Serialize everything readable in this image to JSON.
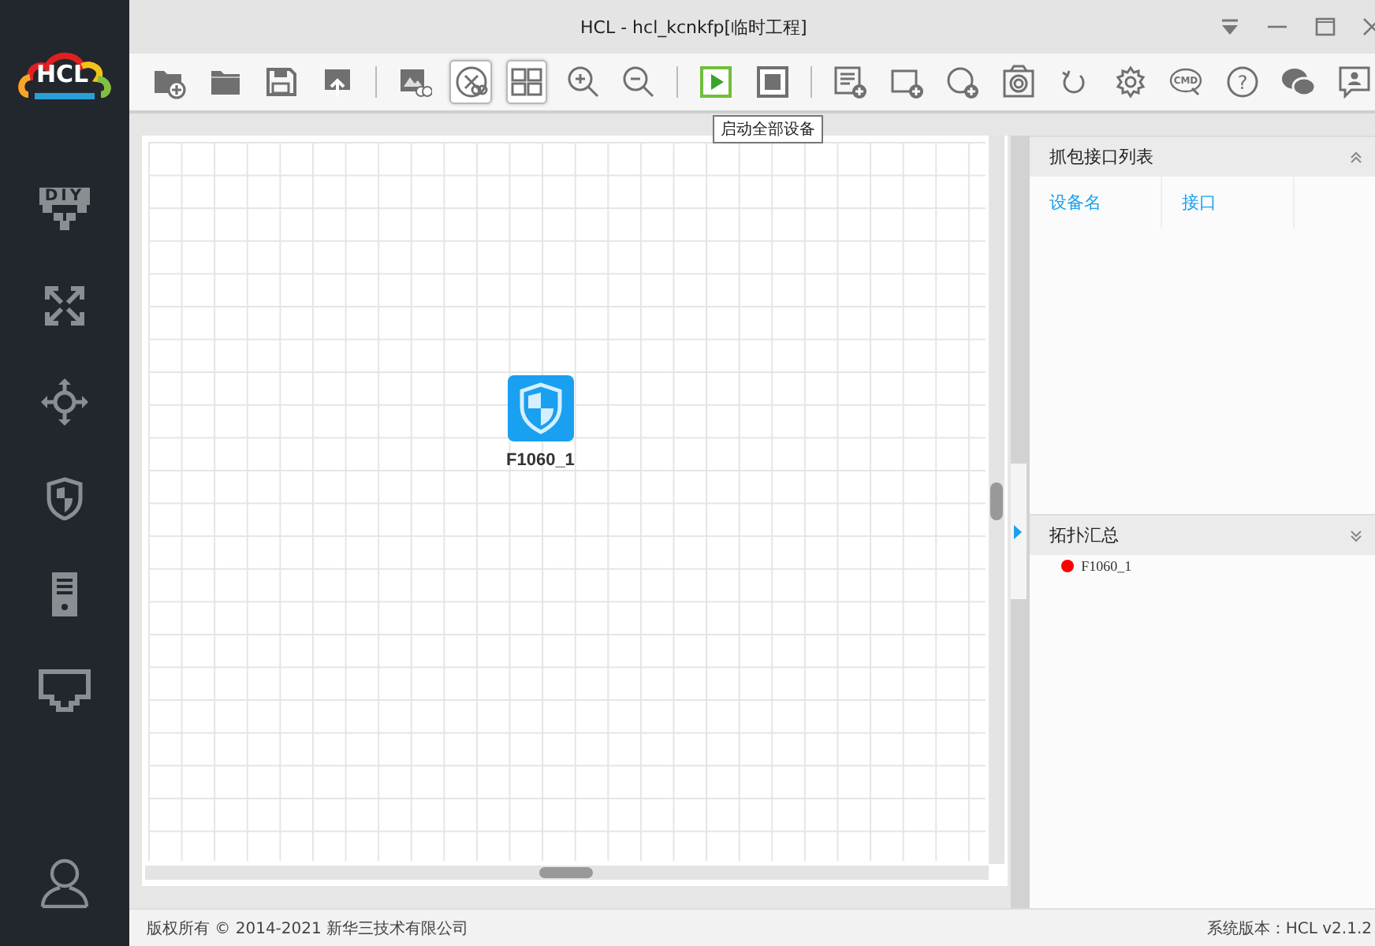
{
  "window": {
    "title": "HCL - hcl_kcnkfp[临时工程]"
  },
  "logo": {
    "text": "HCL"
  },
  "sidebar": {
    "items": [
      {
        "kind": "diy",
        "label": "DIY"
      },
      {
        "kind": "switch"
      },
      {
        "kind": "router"
      },
      {
        "kind": "firewall"
      },
      {
        "kind": "host"
      },
      {
        "kind": "port"
      }
    ],
    "bottom": [
      {
        "kind": "user"
      }
    ]
  },
  "toolbar": [
    {
      "kind": "new",
      "selected": false
    },
    {
      "kind": "open",
      "selected": false
    },
    {
      "kind": "save",
      "selected": false
    },
    {
      "kind": "export",
      "selected": false
    },
    {
      "kind": "sep"
    },
    {
      "kind": "image",
      "selected": false
    },
    {
      "kind": "topology",
      "selected": true
    },
    {
      "kind": "grid",
      "selected": true
    },
    {
      "kind": "zoomin",
      "selected": false
    },
    {
      "kind": "zoomout",
      "selected": false
    },
    {
      "kind": "sep"
    },
    {
      "kind": "start",
      "selected": false
    },
    {
      "kind": "stop",
      "selected": false
    },
    {
      "kind": "sep"
    },
    {
      "kind": "listadd",
      "selected": false
    },
    {
      "kind": "rectadd",
      "selected": false
    },
    {
      "kind": "circleadd",
      "selected": false
    },
    {
      "kind": "camera",
      "selected": false
    },
    {
      "kind": "refresh",
      "selected": false
    },
    {
      "kind": "settings",
      "selected": false
    },
    {
      "kind": "cmd",
      "label": "CMD",
      "selected": false
    },
    {
      "kind": "help",
      "label": "?",
      "selected": false
    },
    {
      "kind": "chat",
      "selected": false
    },
    {
      "kind": "feedback",
      "selected": false
    }
  ],
  "tooltip": "启动全部设备",
  "canvas": {
    "nodes": [
      {
        "kind": "firewall",
        "label": "F1060_1"
      }
    ]
  },
  "capture_panel": {
    "title": "抓包接口列表",
    "columns": [
      "设备名",
      "接口"
    ]
  },
  "topology_panel": {
    "title": "拓扑汇总",
    "items": [
      {
        "name": "F1060_1",
        "color": "#ff0000"
      }
    ]
  },
  "footer": {
    "copyright": "版权所有 © 2014-2021 新华三技术有限公司",
    "version": "系统版本：HCL v2.1.2"
  }
}
